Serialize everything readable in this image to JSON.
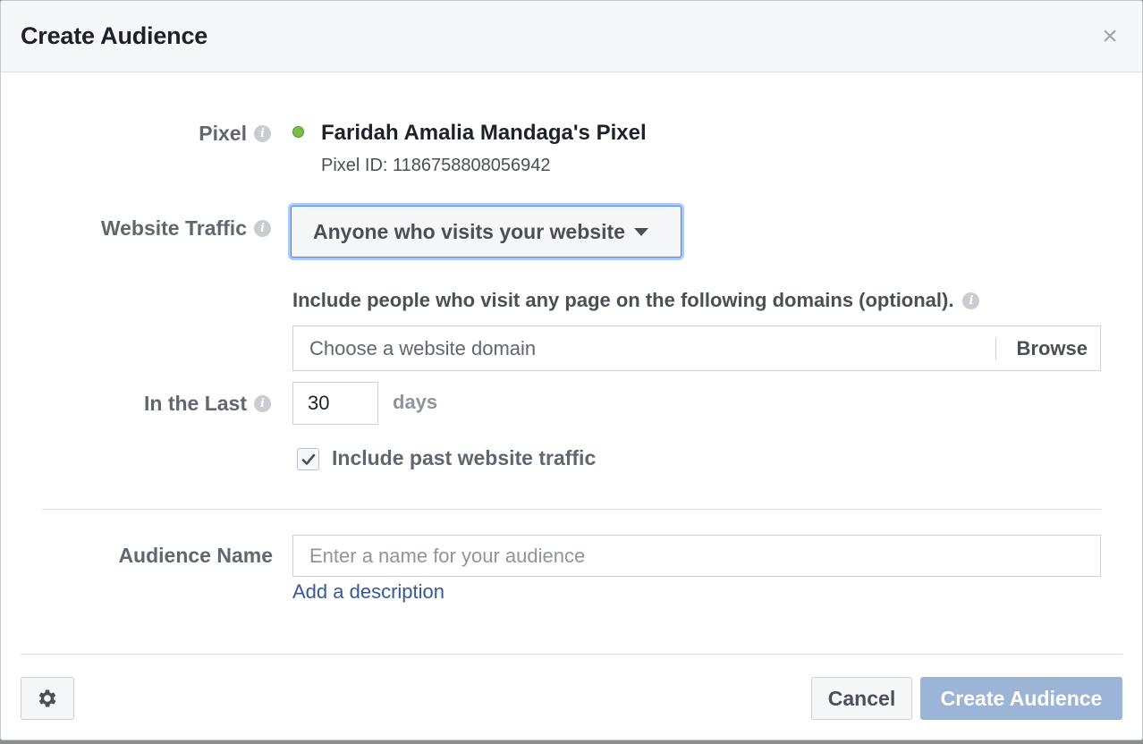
{
  "dialog": {
    "title": "Create Audience",
    "close_glyph": "×"
  },
  "pixel": {
    "label": "Pixel",
    "name": "Faridah Amalia Mandaga's Pixel",
    "id_text": "Pixel ID: 1186758808056942",
    "status_color": "#7bc043"
  },
  "website_traffic": {
    "label": "Website Traffic",
    "selected": "Anyone who visits your website"
  },
  "domains": {
    "instruction": "Include people who visit any page on the following domains (optional).",
    "placeholder": "Choose a website domain",
    "browse_label": "Browse"
  },
  "in_the_last": {
    "label": "In the Last",
    "value": "30",
    "unit": "days"
  },
  "past_traffic": {
    "label": "Include past website traffic",
    "checked": true
  },
  "audience_name": {
    "label": "Audience Name",
    "placeholder": "Enter a name for your audience",
    "add_description": "Add a description"
  },
  "footer": {
    "settings_icon": "gear-icon",
    "cancel_label": "Cancel",
    "create_label": "Create Audience",
    "create_color": "#9cb4d8"
  },
  "info_glyph": "i"
}
